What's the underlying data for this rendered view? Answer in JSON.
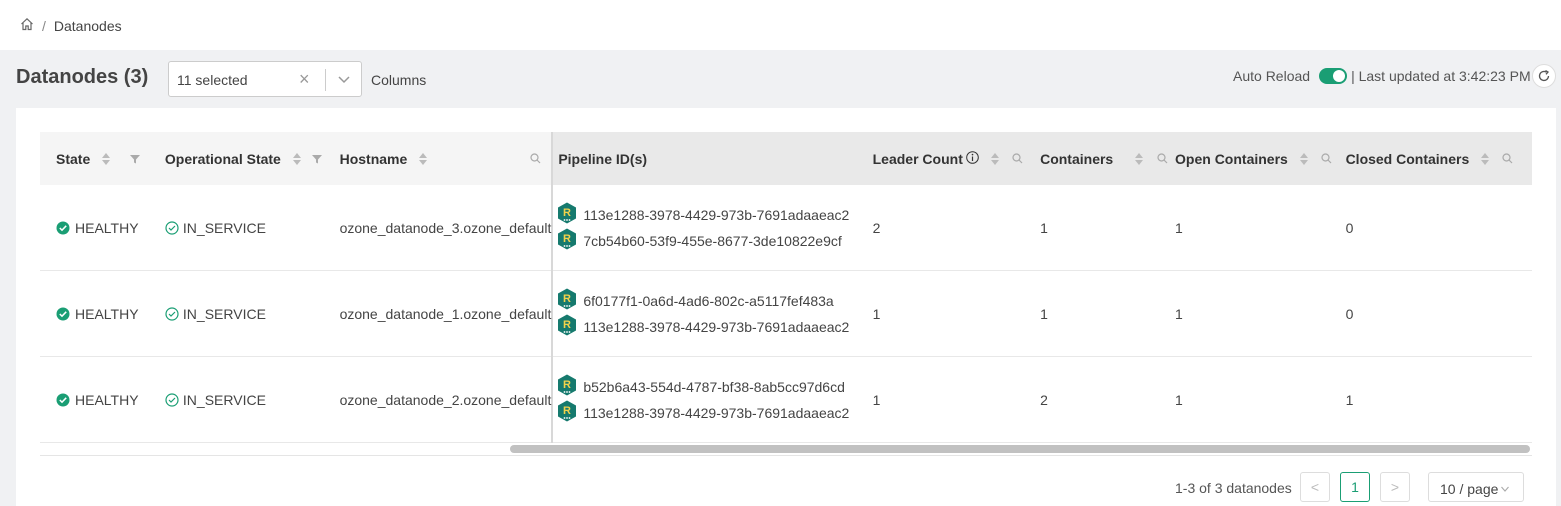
{
  "breadcrumb": {
    "home_icon": "home-icon",
    "separator": "/",
    "current": "Datanodes"
  },
  "header": {
    "title": "Datanodes (3)",
    "columns_select": {
      "value": "11 selected",
      "clear": "×"
    },
    "columns_label": "Columns",
    "auto_reload_label": "Auto Reload",
    "last_updated": "| Last updated at 3:42:23 PM"
  },
  "table": {
    "columns": [
      "State",
      "Operational State",
      "Hostname",
      "Pipeline ID(s)",
      "Leader Count",
      "Containers",
      "Open Containers",
      "Closed Containers"
    ],
    "rows": [
      {
        "state": "HEALTHY",
        "op_state": "IN_SERVICE",
        "hostname": "ozone_datanode_3.ozone_default",
        "pipelines": [
          "113e1288-3978-4429-973b-7691adaaeac2",
          "7cb54b60-53f9-455e-8677-3de10822e9cf"
        ],
        "leader_count": "2",
        "containers": "1",
        "open_containers": "1",
        "closed_containers": "0"
      },
      {
        "state": "HEALTHY",
        "op_state": "IN_SERVICE",
        "hostname": "ozone_datanode_1.ozone_default",
        "pipelines": [
          "6f0177f1-0a6d-4ad6-802c-a5117fef483a",
          "113e1288-3978-4429-973b-7691adaaeac2"
        ],
        "leader_count": "1",
        "containers": "1",
        "open_containers": "1",
        "closed_containers": "0"
      },
      {
        "state": "HEALTHY",
        "op_state": "IN_SERVICE",
        "hostname": "ozone_datanode_2.ozone_default",
        "pipelines": [
          "b52b6a43-554d-4787-bf38-8ab5cc97d6cd",
          "113e1288-3978-4429-973b-7691adaaeac2"
        ],
        "leader_count": "1",
        "containers": "2",
        "open_containers": "1",
        "closed_containers": "1"
      }
    ],
    "pipeline_badge_letter": "R"
  },
  "pagination": {
    "info": "1-3 of 3 datanodes",
    "prev": "<",
    "current": "1",
    "next": ">",
    "page_size": "10 / page"
  },
  "colors": {
    "accent": "#1a9e74",
    "badge_bg": "#167a6e",
    "badge_letter": "#f2d24b"
  }
}
